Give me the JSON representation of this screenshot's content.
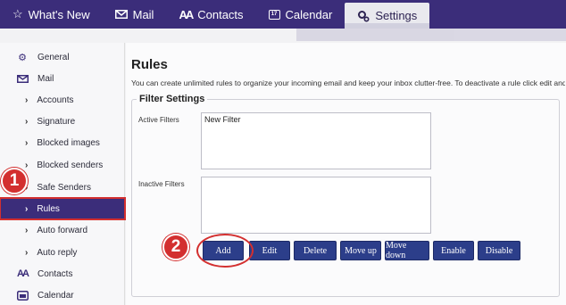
{
  "nav": {
    "tabs": [
      {
        "label": "What's New",
        "icon": "star-icon"
      },
      {
        "label": "Mail",
        "icon": "mail-icon"
      },
      {
        "label": "Contacts",
        "icon": "contacts-icon"
      },
      {
        "label": "Calendar",
        "icon": "calendar-icon",
        "icon_text": "17"
      },
      {
        "label": "Settings",
        "icon": "settings-icon"
      }
    ],
    "active": "Settings"
  },
  "sidebar": {
    "items": [
      {
        "label": "General",
        "icon": "gear-icon"
      },
      {
        "label": "Mail",
        "icon": "mail-icon"
      },
      {
        "label": "Accounts"
      },
      {
        "label": "Signature"
      },
      {
        "label": "Blocked images"
      },
      {
        "label": "Blocked senders"
      },
      {
        "label": "Safe Senders"
      },
      {
        "label": "Rules",
        "selected": true
      },
      {
        "label": "Auto forward"
      },
      {
        "label": "Auto reply"
      },
      {
        "label": "Contacts",
        "icon": "contacts-icon"
      },
      {
        "label": "Calendar",
        "icon": "calendar-icon"
      }
    ]
  },
  "main": {
    "title": "Rules",
    "description": "You can create unlimited rules to organize your incoming email and keep your inbox clutter-free. To deactivate a rule click edit and",
    "filter_settings": {
      "legend": "Filter Settings",
      "active_label": "Active Filters",
      "active_items": [
        "New Filter"
      ],
      "inactive_label": "Inactive Filters",
      "inactive_items": []
    },
    "buttons": [
      "Add",
      "Edit",
      "Delete",
      "Move up",
      "Move down",
      "Enable",
      "Disable"
    ]
  },
  "annotations": {
    "step1": "1",
    "step2": "2"
  },
  "colors": {
    "brand": "#3b2d7a",
    "button": "#2c3e8a",
    "annotation": "#d32f2f"
  }
}
